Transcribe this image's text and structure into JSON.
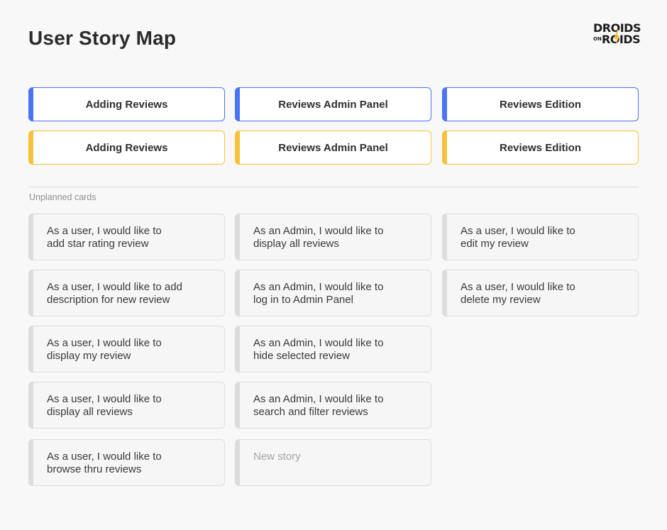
{
  "page": {
    "title": "User Story Map"
  },
  "logo": {
    "line1": "DROIDS",
    "line2_small": "ON",
    "line2": "ROIDS"
  },
  "epics_primary": [
    "Adding Reviews",
    "Reviews Admin Panel",
    "Reviews Edition"
  ],
  "epics_secondary": [
    "Adding Reviews",
    "Reviews Admin Panel",
    "Reviews Edition"
  ],
  "colors": {
    "primary_accent": "#4a74f5",
    "secondary_accent": "#f7c23a",
    "card_accent": "#dcdcdc"
  },
  "unplanned": {
    "label": "Unplanned cards",
    "columns": [
      [
        "As a user, I would like to\nadd star rating review",
        "As a user, I would like to add\ndescription for new review",
        "As a user, I would like to\ndisplay my review",
        "As a user, I would like to\ndisplay all reviews",
        "As a user, I would like to\nbrowse thru reviews"
      ],
      [
        "As an Admin, I would like to\ndisplay all reviews",
        "As an Admin, I would like to\nlog in to Admin Panel",
        "As an Admin, I would like to\nhide selected review",
        "As an Admin, I would like to\nsearch and filter reviews"
      ],
      [
        "As a user, I would like to\nedit my review",
        "As a user, I would like to\ndelete my review"
      ]
    ],
    "new_story_placeholder": "New story"
  }
}
